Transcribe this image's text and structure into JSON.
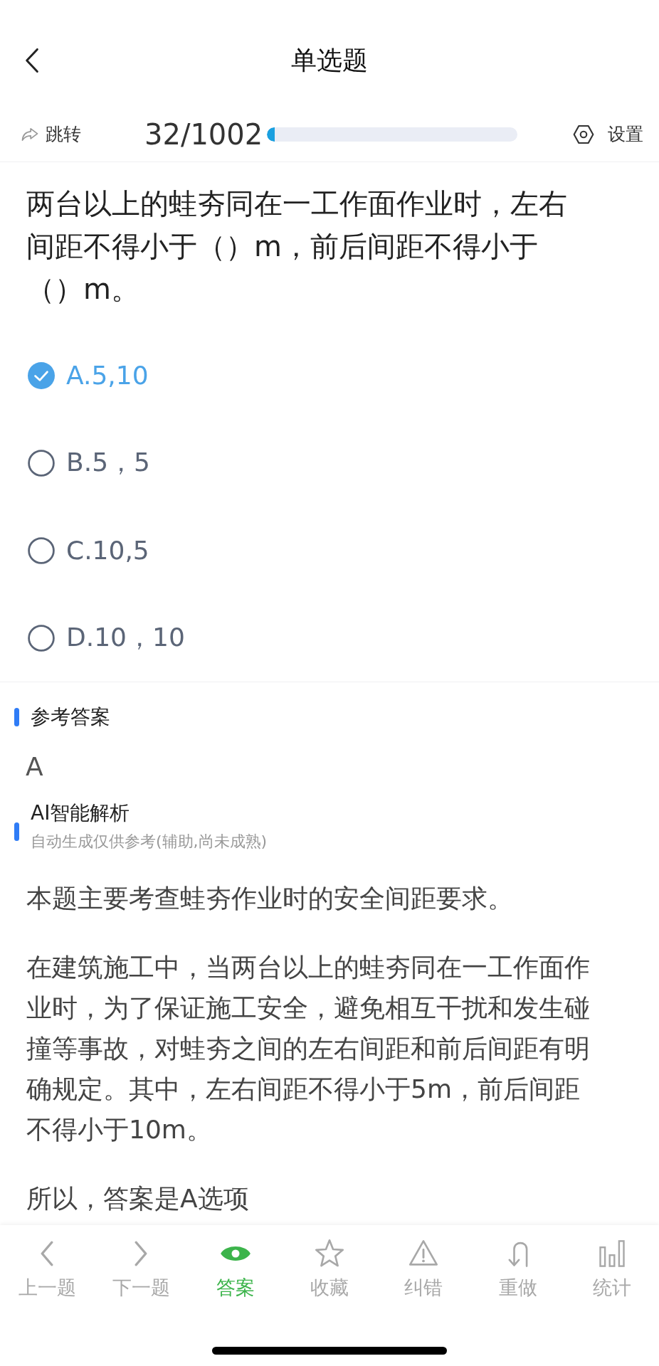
{
  "nav": {
    "title": "单选题"
  },
  "toolbar": {
    "jump": "跳转",
    "progress_text": "32/1002",
    "progress": {
      "level": 0.032
    },
    "settings": "设置"
  },
  "question": {
    "text": "两台以上的蛙夯同在一工作面作业时，左右间距不得小于（）m，前后间距不得小于（）m。"
  },
  "options": [
    {
      "label": "A.5,10",
      "selected": true
    },
    {
      "label": "B.5，5",
      "selected": false
    },
    {
      "label": "C.10,5",
      "selected": false
    },
    {
      "label": "D.10，10",
      "selected": false
    }
  ],
  "reference": {
    "heading": "参考答案",
    "answer": "A"
  },
  "analysis": {
    "heading": "AI智能解析",
    "subtitle": "自动生成仅供参考(辅助,尚未成熟)",
    "paragraphs": [
      "本题主要考查蛙夯作业时的安全间距要求。",
      "在建筑施工中，当两台以上的蛙夯同在一工作面作业时，为了保证施工安全，避免相互干扰和发生碰撞等事故，对蛙夯之间的左右间距和前后间距有明确规定。其中，左右间距不得小于5m，前后间距不得小于10m。",
      "所以，答案是A选项"
    ]
  },
  "tabs": [
    {
      "kind": "prev",
      "label": "上一题",
      "selected": false
    },
    {
      "kind": "next",
      "label": "下一题",
      "selected": false
    },
    {
      "kind": "answer",
      "label": "答案",
      "selected": true
    },
    {
      "kind": "favorite",
      "label": "收藏",
      "selected": false
    },
    {
      "kind": "report",
      "label": "纠错",
      "selected": false
    },
    {
      "kind": "redo",
      "label": "重做",
      "selected": false
    },
    {
      "kind": "stats",
      "label": "统计",
      "selected": false
    }
  ]
}
